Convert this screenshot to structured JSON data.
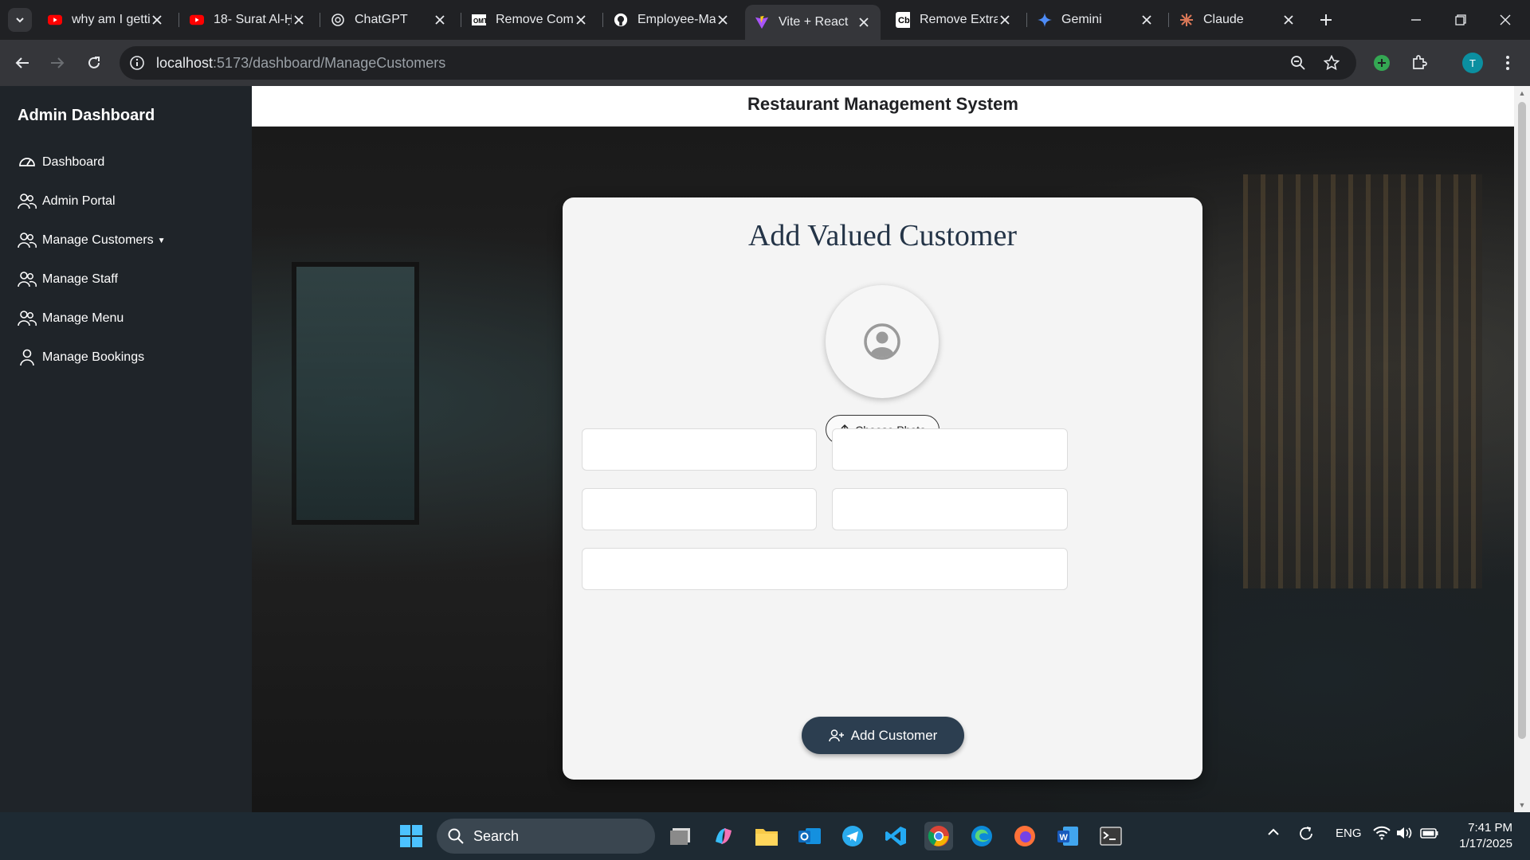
{
  "browser": {
    "tabs": [
      {
        "title": "why am I getting",
        "favicon": "youtube-icon",
        "active": false
      },
      {
        "title": "18- Surat Al-Ḥ",
        "favicon": "youtube-icon",
        "active": false
      },
      {
        "title": "ChatGPT",
        "favicon": "chatgpt-icon",
        "active": false
      },
      {
        "title": "Remove Com",
        "favicon": "omt-icon",
        "active": false
      },
      {
        "title": "Employee-Ma",
        "favicon": "github-icon",
        "active": false
      },
      {
        "title": "Vite + React",
        "favicon": "vite-icon",
        "active": true
      },
      {
        "title": "Remove Extra",
        "favicon": "cb-icon",
        "active": false
      },
      {
        "title": "Gemini",
        "favicon": "gemini-icon",
        "active": false
      },
      {
        "title": "Claude",
        "favicon": "claude-icon",
        "active": false
      }
    ],
    "url_host": "localhost",
    "url_path": ":5173/dashboard/ManageCustomers",
    "profile_initial": "T"
  },
  "sidebar": {
    "title": "Admin Dashboard",
    "items": [
      {
        "label": "Dashboard",
        "icon": "speedometer-icon"
      },
      {
        "label": "Admin Portal",
        "icon": "people-icon"
      },
      {
        "label": "Manage Customers",
        "icon": "people-icon",
        "dropdown": true
      },
      {
        "label": "Manage Staff",
        "icon": "people-icon"
      },
      {
        "label": "Manage Menu",
        "icon": "people-icon"
      },
      {
        "label": "Manage Bookings",
        "icon": "person-icon"
      }
    ]
  },
  "header": {
    "title": "Restaurant Management System"
  },
  "form": {
    "title": "Add Valued Customer",
    "choose_photo_label": "Choose Photo",
    "fields": [
      "",
      "",
      "",
      "",
      ""
    ],
    "submit_label": "Add Customer"
  },
  "taskbar": {
    "search_label": "Search",
    "language": "ENG",
    "time": "7:41 PM",
    "date": "1/17/2025"
  },
  "colors": {
    "sidebar_bg": "#1f2429",
    "button_bg": "#2c3e50",
    "title_color": "#243447"
  }
}
